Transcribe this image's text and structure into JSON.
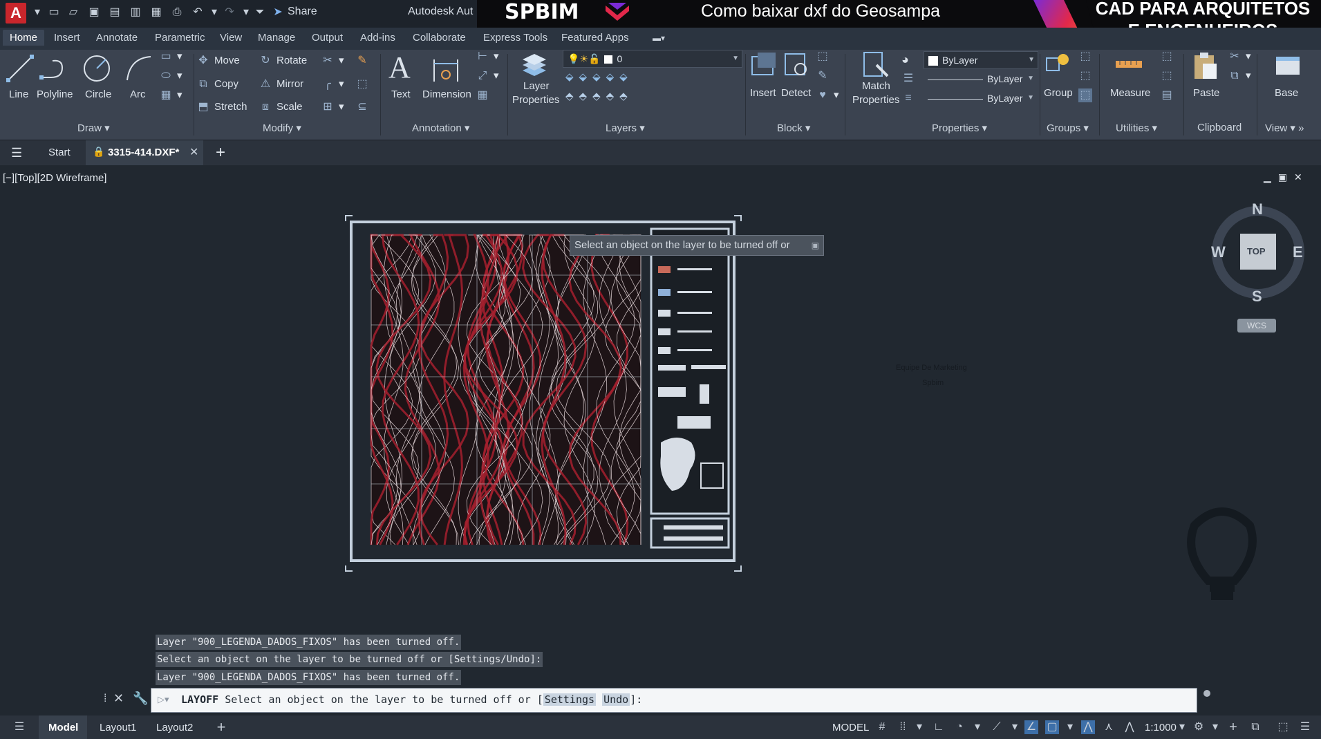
{
  "titlebar": {
    "app_logo_letter": "A",
    "share_label": "Share",
    "app_title": "Autodesk AutoCAD",
    "banner_brand": "SPBIM",
    "banner_video_title": "Como baixar dxf do Geosampa",
    "banner_cad_line1": "CAD PARA ARQUITETOS",
    "banner_cad_line2": "E ENGENHEIROS"
  },
  "ribbon_tabs": [
    "Home",
    "Insert",
    "Annotate",
    "Parametric",
    "View",
    "Manage",
    "Output",
    "Add-ins",
    "Collaborate",
    "Express Tools",
    "Featured Apps"
  ],
  "ribbon": {
    "draw": {
      "line": "Line",
      "polyline": "Polyline",
      "circle": "Circle",
      "arc": "Arc",
      "title": "Draw"
    },
    "modify": {
      "move": "Move",
      "rotate": "Rotate",
      "copy": "Copy",
      "mirror": "Mirror",
      "stretch": "Stretch",
      "scale": "Scale",
      "title": "Modify"
    },
    "annotation": {
      "text": "Text",
      "dimension": "Dimension",
      "title": "Annotation"
    },
    "layers": {
      "layer_properties_1": "Layer",
      "layer_properties_2": "Properties",
      "current_layer": "0",
      "title": "Layers"
    },
    "block": {
      "insert": "Insert",
      "detect": "Detect",
      "title": "Block"
    },
    "properties": {
      "match_1": "Match",
      "match_2": "Properties",
      "color": "ByLayer",
      "linetype": "ByLayer",
      "lineweight": "ByLayer",
      "title": "Properties"
    },
    "groups": {
      "group": "Group",
      "title": "Groups"
    },
    "utilities": {
      "measure": "Measure",
      "title": "Utilities"
    },
    "clipboard": {
      "paste": "Paste",
      "title": "Clipboard"
    },
    "view": {
      "base": "Base",
      "title": "View"
    }
  },
  "filetabs": {
    "start": "Start",
    "file": "3315-414.DXF*"
  },
  "viewport": {
    "label": "[−][Top][2D Wireframe]"
  },
  "tooltip": "Select an object on the layer to be turned off or",
  "viewcube": {
    "n": "N",
    "s": "S",
    "e": "E",
    "w": "W",
    "top": "TOP",
    "wcs": "WCS"
  },
  "watermark": {
    "line1": "Equipe De Marketing",
    "line2": "Spbim"
  },
  "command_history": [
    "Layer \"900_LEGENDA_DADOS_FIXOS\" has been turned off.",
    "Select an object on the layer to be turned off or [Settings/Undo]:",
    "Layer \"900_LEGENDA_DADOS_FIXOS\" has been turned off."
  ],
  "command_line": {
    "command": "LAYOFF",
    "prompt": " Select an object on the layer to be turned off or [",
    "opt1": "Settings",
    "opt2": "Undo",
    "end": "]:"
  },
  "statusbar": {
    "model_tab": "Model",
    "layout1": "Layout1",
    "layout2": "Layout2",
    "model_indicator": "MODEL",
    "scale": "1:1000"
  },
  "colors": {
    "accent": "#c9262c",
    "viewport_bg": "#212830",
    "map_red": "#a5202e"
  }
}
